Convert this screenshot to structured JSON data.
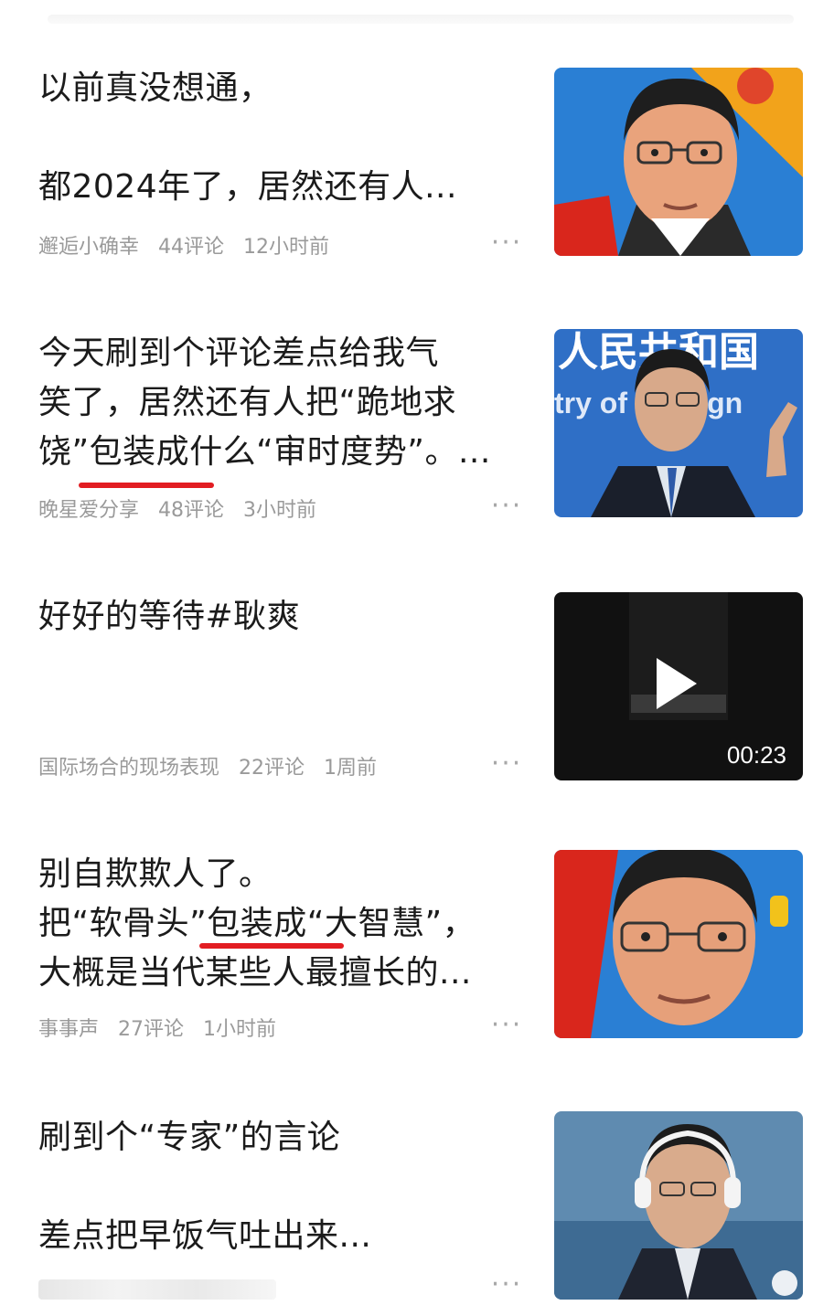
{
  "feed": [
    {
      "lines": [
        "以前真没想通，",
        "",
        "都2024年了，居然还有人..."
      ],
      "author": "邂逅小确幸",
      "comments": "44评论",
      "time": "12小时前",
      "thumb": "portrait-illustration-1"
    },
    {
      "lines": [
        "今天刷到个评论差点给我气",
        "笑了，居然还有人把“跪地求",
        "饶”包装成什么“审时度势”。..."
      ],
      "author": "晚星爱分享",
      "comments": "48评论",
      "time": "3小时前",
      "thumb": "press-conference-photo",
      "thumb_text": [
        "人民共和国",
        "try of Foreign"
      ]
    },
    {
      "lines": [
        "好好的等待#耿爽"
      ],
      "author": "国际场合的现场表现",
      "comments": "22评论",
      "time": "1周前",
      "thumb": "video-thumbnail",
      "duration": "00:23"
    },
    {
      "lines": [
        "别自欺欺人了。",
        "把“软骨头”包装成“大智慧”，",
        "大概是当代某些人最擅长的..."
      ],
      "author": "事事声",
      "comments": "27评论",
      "time": "1小时前",
      "thumb": "portrait-illustration-2"
    },
    {
      "lines": [
        "刷到个“专家”的言论",
        "",
        "差点把早饭气吐出来..."
      ],
      "author": "",
      "comments": "",
      "time": "",
      "thumb": "headset-photo"
    }
  ],
  "more_label": "···",
  "colors": {
    "accent_underline": "#e21d22",
    "meta": "#9a9a9a",
    "title": "#1b1b1b"
  }
}
